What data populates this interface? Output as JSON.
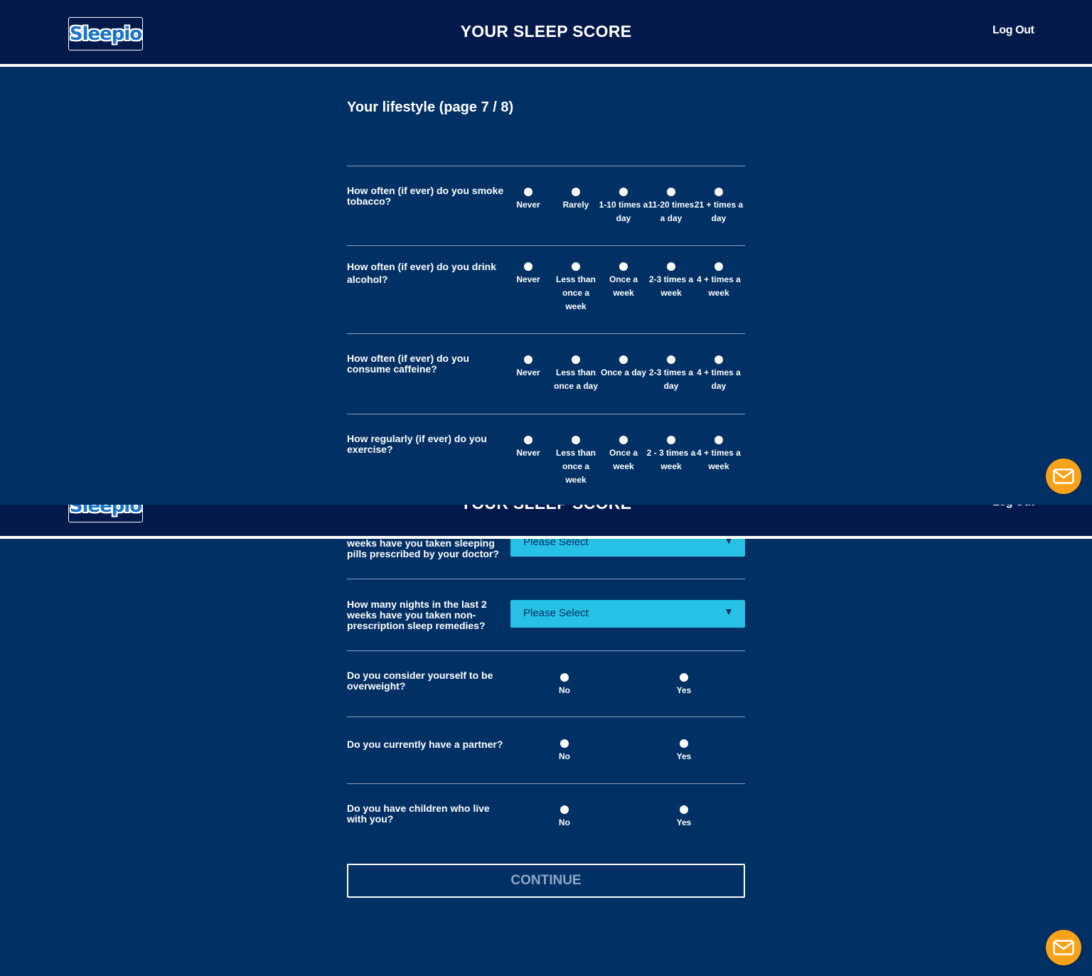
{
  "header": {
    "logo_text": "Sleepio",
    "title": "YOUR SLEEP SCORE",
    "logout_label": "Log Out"
  },
  "page": {
    "title": "Your lifestyle (page 7 / 8)"
  },
  "questions": {
    "smoke": {
      "label": "How often (if ever) do you smoke tobacco?",
      "options": [
        "Never",
        "Rarely",
        "1-10 times a day",
        "11-20 times a day",
        "21 + times a day"
      ]
    },
    "alcohol": {
      "label": "How often (if ever) do you drink alcohol?",
      "options": [
        "Never",
        "Less than once a week",
        "Once a week",
        "2-3 times a week",
        "4 + times a week"
      ]
    },
    "caffeine": {
      "label": "How often (if ever) do you consume caffeine?",
      "options": [
        "Never",
        "Less than once a day",
        "Once a day",
        "2-3 times a day",
        "4 + times a day"
      ]
    },
    "exercise": {
      "label": "How regularly (if ever) do you exercise?",
      "options": [
        "Never",
        "Less than once a week",
        "Once a week",
        "2 - 3 times a week",
        "4 + times a week"
      ]
    },
    "sleeping_pills": {
      "label_partial": "weeks have you taken sleeping pills prescribed by your doctor?",
      "select_value": "Please Select"
    },
    "sleep_remedies": {
      "label": "How many nights in the last 2 weeks have you taken non-prescription sleep remedies?",
      "select_value": "Please Select"
    },
    "overweight": {
      "label": "Do you consider yourself to be overweight?",
      "options": [
        "No",
        "Yes"
      ]
    },
    "partner": {
      "label": "Do you currently have a partner?",
      "options": [
        "No",
        "Yes"
      ]
    },
    "children": {
      "label": "Do you have children who live with you?",
      "options": [
        "No",
        "Yes"
      ]
    }
  },
  "actions": {
    "continue_label": "CONTINUE"
  },
  "icons": {
    "caret": "dropdown-caret-icon",
    "message": "envelope-icon"
  },
  "colors": {
    "background": "#003064",
    "header": "#03194a",
    "select": "#29c0e6",
    "fab": "#f7a21b"
  }
}
